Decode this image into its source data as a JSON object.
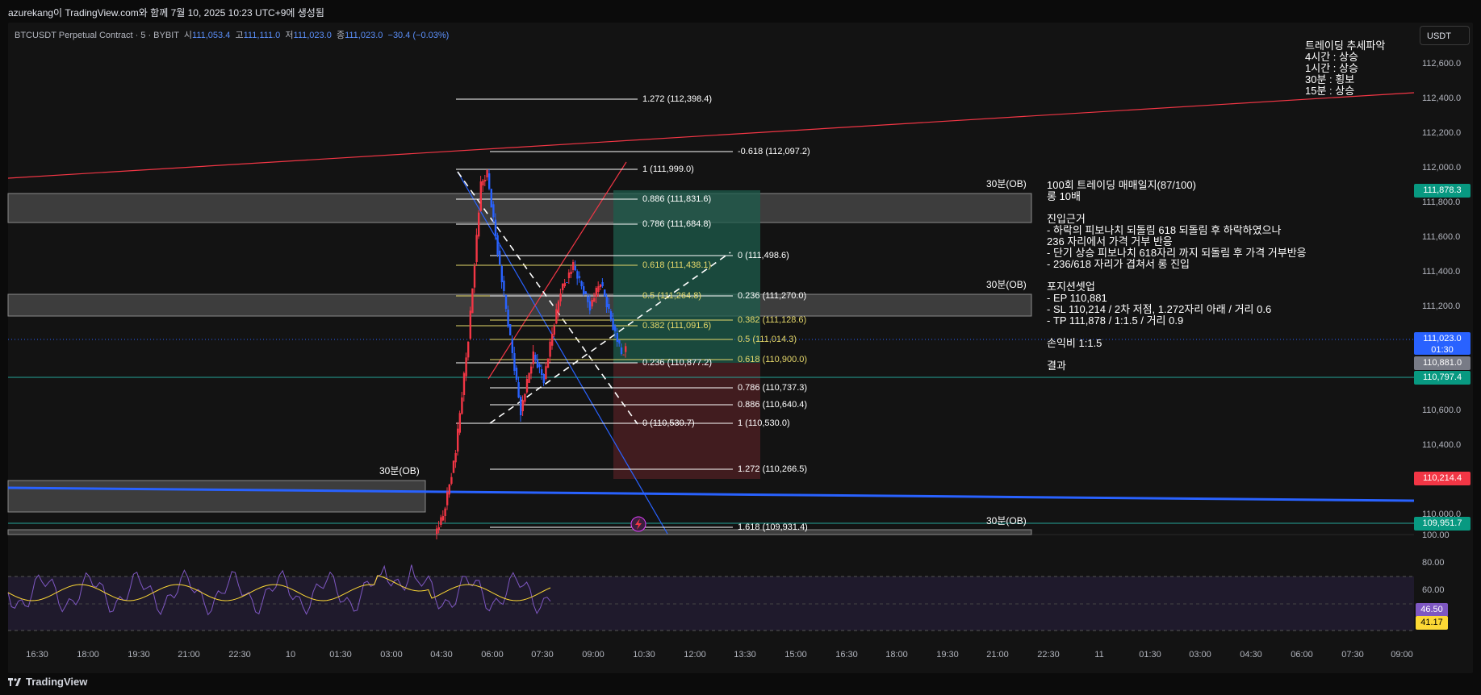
{
  "header": {
    "created_text": "azurekang이 TradingView.com와 함께 7월 10, 2025 10:23 UTC+9에 생성됨"
  },
  "symbol": {
    "name": "BTCUSDT Perpetual Contract · 5 · BYBIT",
    "open_label": "시",
    "open": "111,053.4",
    "high_label": "고",
    "high": "111,111.0",
    "low_label": "저",
    "low": "111,023.0",
    "close_label": "종",
    "close": "111,023.0",
    "change": "−30.4 (−0.03%)"
  },
  "currency_button": "USDT",
  "price_axis": [
    "112,600.0",
    "112,400.0",
    "112,200.0",
    "112,000.0",
    "111,800.0",
    "111,600.0",
    "111,400.0",
    "111,200.0",
    "110,600.0",
    "110,400.0",
    "110,000.0"
  ],
  "price_tags": [
    {
      "text": "111,878.3",
      "color": "#089981"
    },
    {
      "text": "111,023.0",
      "sub": "01:30",
      "color": "#2962ff"
    },
    {
      "text": "110,881.0",
      "color": "#787b86"
    },
    {
      "text": "110,797.4",
      "color": "#089981"
    },
    {
      "text": "110,214.4",
      "color": "#f23645"
    },
    {
      "text": "109,951.7",
      "color": "#089981"
    }
  ],
  "rsi_axis": [
    "100.00",
    "80.00",
    "60.00"
  ],
  "rsi_tags": [
    {
      "text": "46.50",
      "color": "#7e57c2"
    },
    {
      "text": "41.17",
      "color": "#fdd835"
    }
  ],
  "time_axis": [
    "16:30",
    "18:00",
    "19:30",
    "21:00",
    "22:30",
    "10",
    "01:30",
    "03:00",
    "04:30",
    "06:00",
    "07:30",
    "09:00",
    "10:30",
    "12:00",
    "13:30",
    "15:00",
    "16:30",
    "18:00",
    "19:30",
    "21:00",
    "22:30",
    "11",
    "01:30",
    "03:00",
    "04:30",
    "06:00",
    "07:30",
    "09:00"
  ],
  "ob_labels": [
    "30분(OB)",
    "30분(OB)",
    "30분(OB)",
    "30분(OB)"
  ],
  "fib1": [
    "1.272 (112,398.4)",
    "1 (111,999.0)",
    "0.886 (111,831.6)",
    "0.786 (111,684.8)",
    "0.618 (111,438.1)",
    "0.5 (111,264.8)",
    "0.382 (111,091.6)",
    "0.236 (110,877.2)",
    "0 (110,530.7)"
  ],
  "fib2": [
    "-0.618 (112,097.2)",
    "0 (111,498.6)",
    "0.236 (111,270.0)",
    "0.382 (111,128.6)",
    "0.5 (111,014.3)",
    "0.618 (110,900.0)",
    "0.786 (110,737.3)",
    "0.886 (110,640.4)",
    "1 (110,530.0)",
    "1.272 (110,266.5)",
    "1.618 (109,931.4)"
  ],
  "trend_note": "트레이딩 추세파악\n4시간 : 상승\n1시간 : 상승\n30분 : 횡보\n15분 : 상승",
  "journal_note": "100회 트레이딩 매매일지(87/100)\n롱 10배\n\n진입근거\n- 하락의 피보나치 되돌림 618 되돌림 후 하락하였으나\n236 자리에서 가격 거부 반응\n- 단기 상승 피보나치 618자리 까지 되돌림 후 가격 거부반응\n- 236/618 자리가 겹쳐서 롱 진입\n\n포지션셋업\n- EP 110,881\n- SL 110,214 / 2차 저점, 1.272자리 아래 / 거리 0.6\n- TP 111,878 / 1:1.5 / 거리 0.9\n\n손익비 1:1.5\n\n결과",
  "footer_logo": "TradingView",
  "colors": {
    "up": "#f23645",
    "down": "#2962ff",
    "fib_white": "#ffffff",
    "fib_yellow": "#e6d96b",
    "green_zone": "#1e5c4c",
    "red_zone": "#4a1f22",
    "trend_red": "#f23645",
    "trend_blue": "#2962ff",
    "rsi": "#7e57c2",
    "rsi_ma": "#fdd835"
  }
}
